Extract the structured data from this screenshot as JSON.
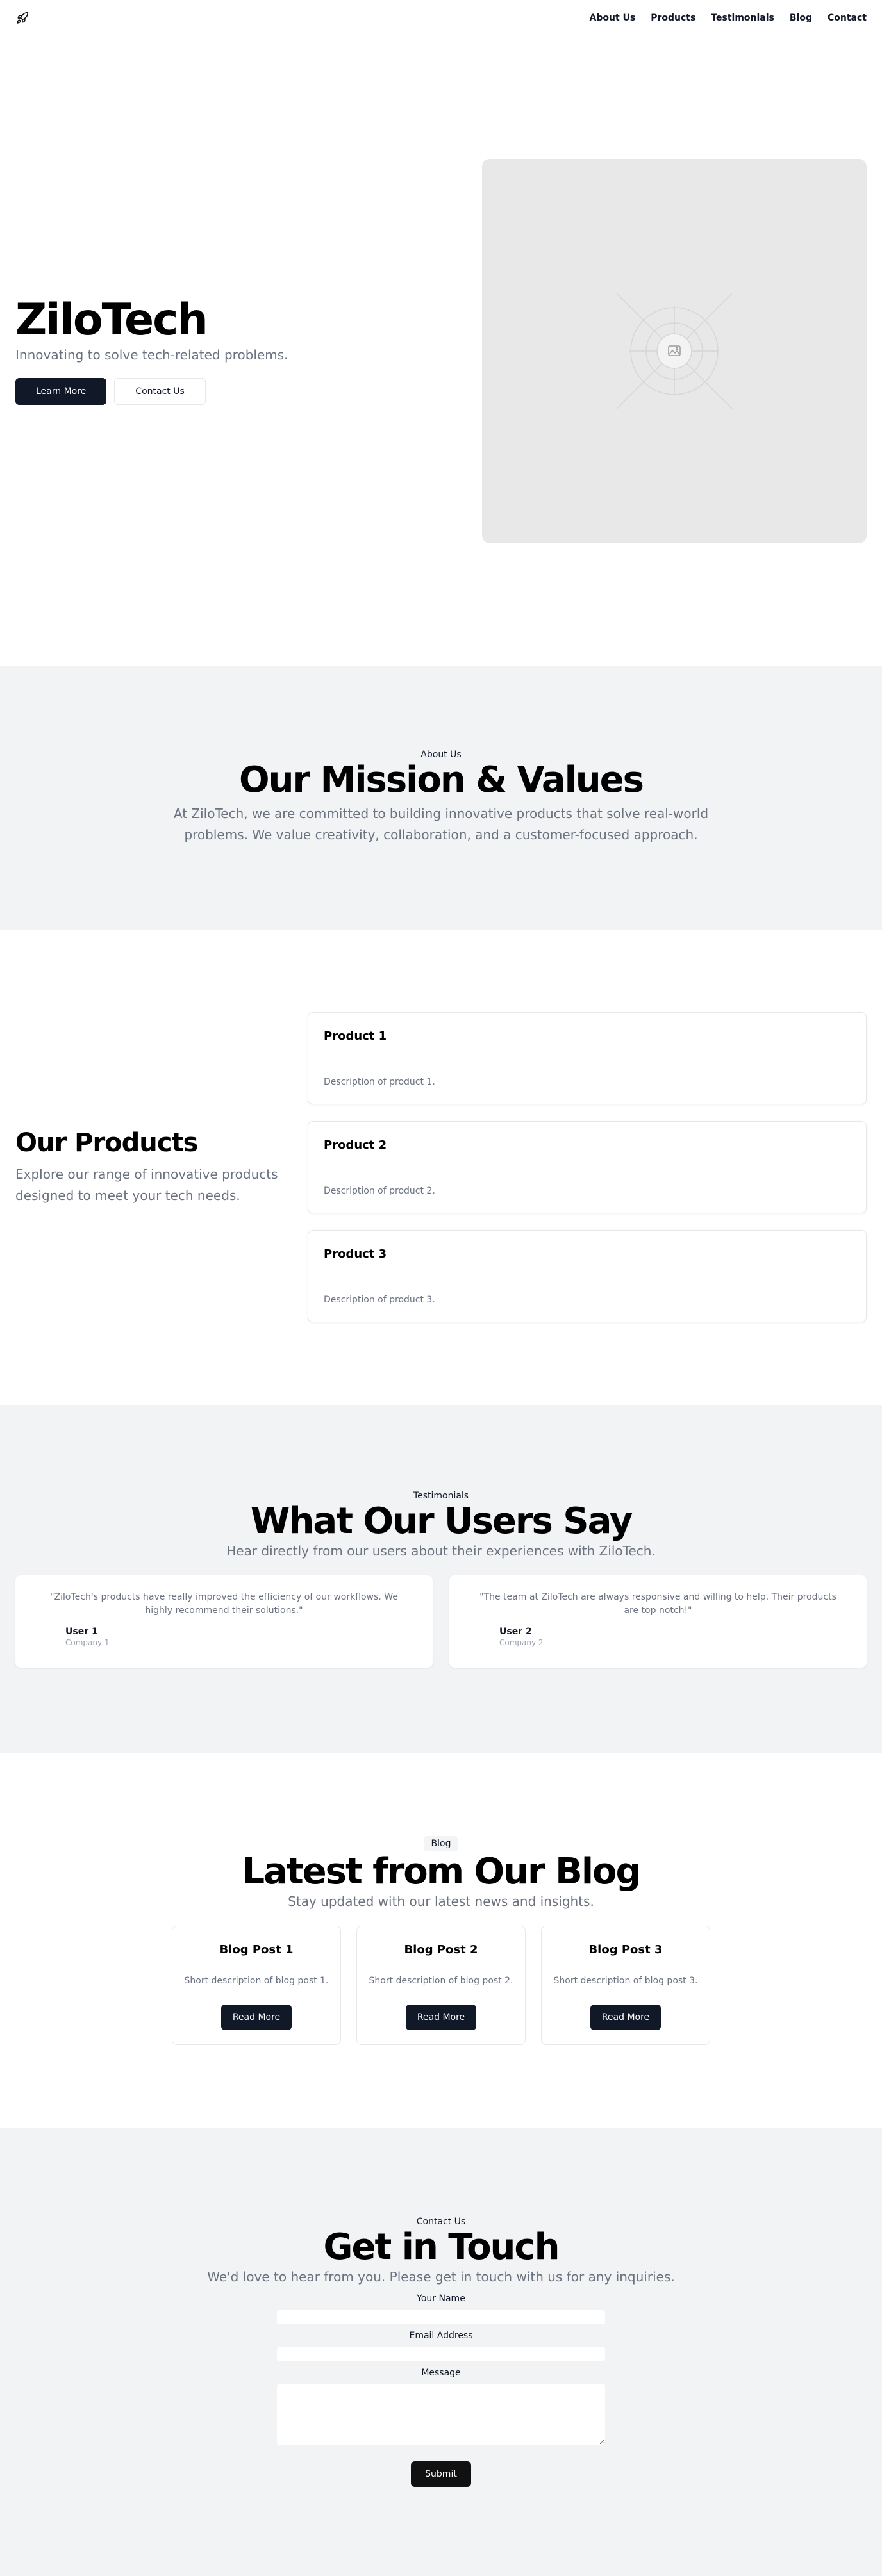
{
  "header": {
    "nav": [
      "About Us",
      "Products",
      "Testimonials",
      "Blog",
      "Contact"
    ]
  },
  "hero": {
    "title": "ZiloTech",
    "subtitle": "Innovating to solve tech-related problems.",
    "primary_button": "Learn More",
    "secondary_button": "Contact Us"
  },
  "about": {
    "eyebrow": "About Us",
    "title": "Our Mission & Values",
    "text": "At ZiloTech, we are committed to building innovative products that solve real-world problems. We value creativity, collaboration, and a customer-focused approach."
  },
  "products": {
    "title": "Our Products",
    "subtitle": "Explore our range of innovative products designed to meet your tech needs.",
    "items": [
      {
        "name": "Product 1",
        "description": "Description of product 1."
      },
      {
        "name": "Product 2",
        "description": "Description of product 2."
      },
      {
        "name": "Product 3",
        "description": "Description of product 3."
      }
    ]
  },
  "testimonials": {
    "eyebrow": "Testimonials",
    "title": "What Our Users Say",
    "subtitle": "Hear directly from our users about their experiences with ZiloTech.",
    "items": [
      {
        "quote": "\"ZiloTech's products have really improved the efficiency of our workflows. We highly recommend their solutions.\"",
        "user": "User 1",
        "company": "Company 1"
      },
      {
        "quote": "\"The team at ZiloTech are always responsive and willing to help. Their products are top notch!\"",
        "user": "User 2",
        "company": "Company 2"
      }
    ]
  },
  "blog": {
    "badge": "Blog",
    "title": "Latest from Our Blog",
    "subtitle": "Stay updated with our latest news and insights.",
    "posts": [
      {
        "title": "Blog Post 1",
        "description": "Short description of blog post 1.",
        "button": "Read More"
      },
      {
        "title": "Blog Post 2",
        "description": "Short description of blog post 2.",
        "button": "Read More"
      },
      {
        "title": "Blog Post 3",
        "description": "Short description of blog post 3.",
        "button": "Read More"
      }
    ]
  },
  "contact": {
    "eyebrow": "Contact Us",
    "title": "Get in Touch",
    "subtitle": "We'd love to hear from you. Please get in touch with us for any inquiries.",
    "name_label": "Your Name",
    "email_label": "Email Address",
    "message_label": "Message",
    "submit": "Submit"
  },
  "icons": {
    "logo": "rocket-icon",
    "hero_image": "image-placeholder-icon"
  }
}
